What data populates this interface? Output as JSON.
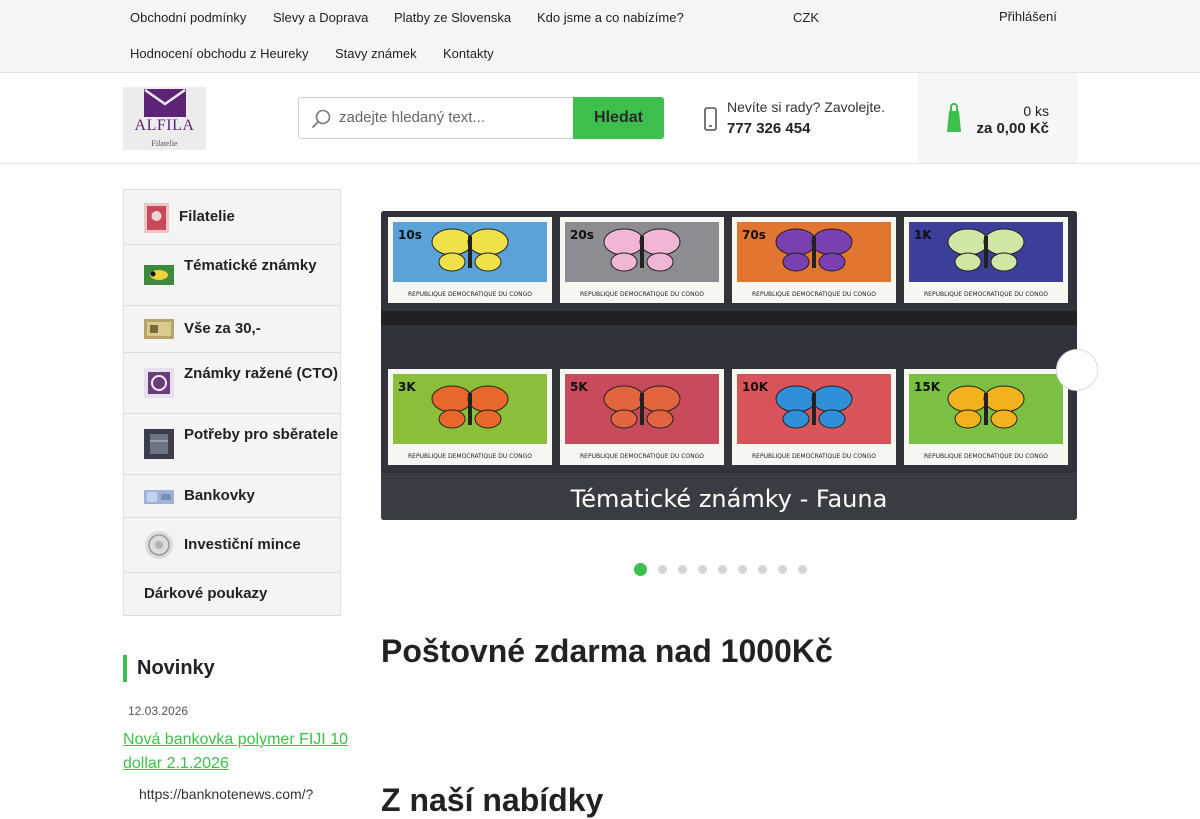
{
  "topnav": {
    "links": [
      "Obchodní podmínky",
      "Slevy a Doprava",
      "Platby ze Slovenska",
      "Kdo jsme a co nabízíme?",
      "Hodnocení obchodu z Heureky",
      "Stavy známek",
      "Kontakty"
    ],
    "currency": "CZK",
    "login": "Přihlášení"
  },
  "header": {
    "logo_text": "ALFILA",
    "logo_sub": "Filatelie",
    "search_placeholder": "zadejte hledaný text...",
    "search_button": "Hledat",
    "help_text": "Nevíte si rady? Zavolejte.",
    "phone": "777 326 454",
    "cart_count": "0 ks",
    "cart_total": "za 0,00 Kč"
  },
  "sidebar": {
    "categories": [
      "Filatelie",
      "Tématické známky",
      "Vše za 30,-",
      "Známky ražené (CTO)",
      "Potřeby pro sběratele",
      "Bankovky",
      "Investiční mince",
      "Dárkové poukazy"
    ]
  },
  "news": {
    "title": "Novinky",
    "date": "12.03.2026",
    "headline": "Nová bankovka polymer FIJI 10 dollar 2.1.2026",
    "snippet": "https://banknotenews.com/?"
  },
  "banner": {
    "caption": "Tématické známky - Fauna",
    "stamp_values": [
      "10s",
      "20s",
      "70s",
      "1K",
      "3K",
      "5K",
      "10K",
      "15K"
    ],
    "stamp_country": "REPUBLIQUE DEMOCRATIQUE DU CONGO",
    "slide_count": 9,
    "active_slide": 1
  },
  "main": {
    "shipping_heading": "Poštovné zdarma nad 1000Kč",
    "offer_heading": "Z naší nabídky"
  },
  "colors": {
    "accent": "#3dbf4c",
    "brand": "#5c2377",
    "topbar_bg": "#f5f5f5"
  }
}
